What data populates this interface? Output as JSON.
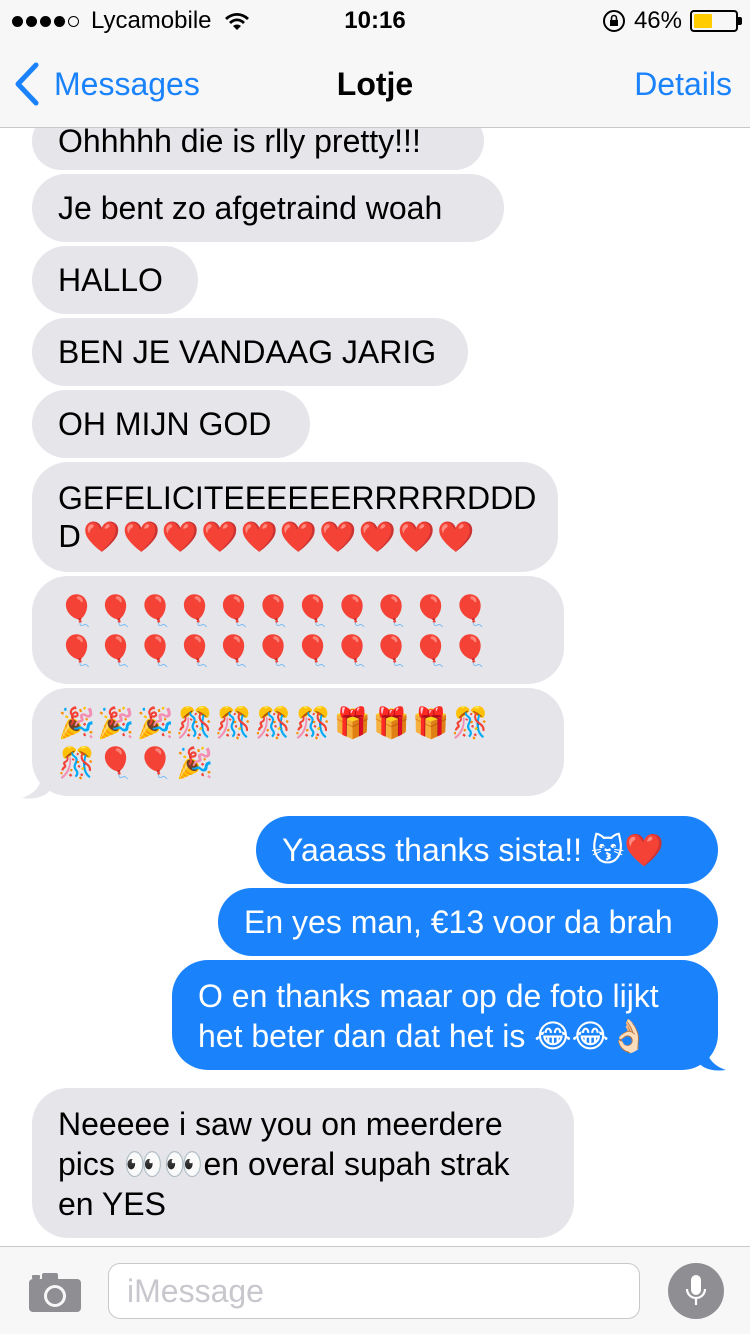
{
  "status_bar": {
    "carrier": "Lycamobile",
    "time": "10:16",
    "battery_percent": "46%",
    "battery_level": 0.46,
    "signal_bars": 4,
    "icons": [
      "wifi-icon",
      "rotation-lock-icon",
      "battery-icon"
    ]
  },
  "nav": {
    "back_label": "Messages",
    "title": "Lotje",
    "details_label": "Details"
  },
  "messages": [
    {
      "direction": "in",
      "lines": [
        "Ohhhhh die is rlly pretty!!!"
      ]
    },
    {
      "direction": "in",
      "lines": [
        "Je bent zo afgetraind woah"
      ]
    },
    {
      "direction": "in",
      "lines": [
        "HALLO"
      ]
    },
    {
      "direction": "in",
      "lines": [
        "BEN JE VANDAAG JARIG"
      ]
    },
    {
      "direction": "in",
      "lines": [
        "OH MIJN GOD"
      ]
    },
    {
      "direction": "in",
      "lines": [
        "GEFELICITEEEEEERRRRRDDD",
        "D❤️❤️❤️❤️❤️❤️❤️❤️❤️❤️"
      ]
    },
    {
      "direction": "in",
      "lines": [
        "🎈🎈🎈🎈🎈🎈🎈🎈🎈🎈🎈",
        "🎈🎈🎈🎈🎈🎈🎈🎈🎈🎈🎈"
      ]
    },
    {
      "direction": "in",
      "lines": [
        "🎉🎉🎉🎊🎊🎊🎊🎁🎁🎁🎊",
        "🎊🎈🎈🎉"
      ]
    },
    {
      "direction": "out",
      "lines": [
        "Yaaass thanks sista!! 😽❤️"
      ]
    },
    {
      "direction": "out",
      "lines": [
        "En yes man, €13 voor da brah"
      ]
    },
    {
      "direction": "out",
      "lines": [
        "O en thanks maar op de foto lijkt",
        "het beter dan dat het is 😂😂👌🏻"
      ]
    },
    {
      "direction": "in",
      "lines": [
        "Neeeee i saw you on meerdere",
        "pics 👀👀en overal supah strak",
        "en YES"
      ]
    }
  ],
  "input": {
    "placeholder": "iMessage",
    "camera_icon": "camera-icon",
    "mic_icon": "microphone-icon"
  },
  "colors": {
    "incoming_bubble": "#e5e5ea",
    "outgoing_bubble": "#1a82fb",
    "accent": "#1a82fb",
    "bar_background": "#f7f7f7"
  }
}
